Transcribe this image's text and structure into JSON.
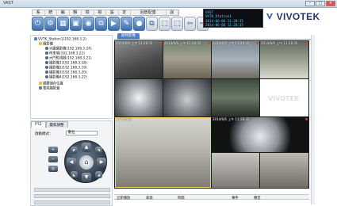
{
  "window": {
    "title": "VAST"
  },
  "menu": {
    "items": [
      "系",
      "統",
      "編",
      "輯",
      "檢",
      "視",
      "設",
      "定",
      "回放配置",
      "說"
    ]
  },
  "toolbar": {
    "buttons": [
      "⏻",
      "⚙",
      "▦",
      "▣",
      "◉",
      "⧉",
      "▶",
      "✎",
      "●",
      "⧉",
      "⬚",
      "⬚",
      "⇦",
      "⇨",
      "⬚",
      "⬚"
    ]
  },
  "clock": {
    "lines": [
      "VAST",
      "VVTK_Station1",
      "2014-06-06 11:28:35",
      "2014-06-06 11:28:35"
    ]
  },
  "brand": {
    "name": "VIVOTEK"
  },
  "tree": {
    "root": "VVTK_Station1(192.168.3.2)",
    "group": "攝影機",
    "cameras": [
      "大廳攝影機(192.168.3.24)",
      "停車場(192.168.3.22)",
      "大門監視器(192.168.3.21)",
      "攝影機1(192.168.3.18)",
      "攝影機2(192.168.3.19)",
      "攝影機3(192.168.3.20)",
      "攝影機4(192.168.3.22)"
    ],
    "extra": [
      "媒體儲存位置",
      "電視牆配置"
    ]
  },
  "ptz": {
    "tabs": [
      "PTZ",
      "變焦調整"
    ],
    "mode_label": "啟動模式：",
    "mode_value": "數位",
    "home_icon": "home-icon"
  },
  "view": {
    "tab_label": "即時影像"
  },
  "tiles": [
    {
      "caption": "2014/6/6 上午 11:28:35"
    },
    {
      "caption": "2014/6/6 上午 11:28:35"
    },
    {
      "caption": "2014/6/6 上午 11:28:35"
    },
    {
      "caption": "2014/6/6 上午 11:28:35"
    },
    {
      "caption": ""
    },
    {
      "caption": ""
    },
    {
      "caption": ""
    },
    {
      "caption": ""
    },
    {
      "caption": "大門監視器"
    },
    {
      "caption": "2014/6/6 上午 11:28:35"
    },
    {
      "caption": ""
    },
    {
      "caption": ""
    }
  ],
  "log": {
    "columns": [
      "立即播放",
      "來源",
      "時間",
      "事件",
      "類型"
    ]
  },
  "colors": {
    "accent": "#4f7fbf",
    "clock_text": "#4fd0ff",
    "highlight": "#ffd34a",
    "record": "#e23b3b"
  }
}
